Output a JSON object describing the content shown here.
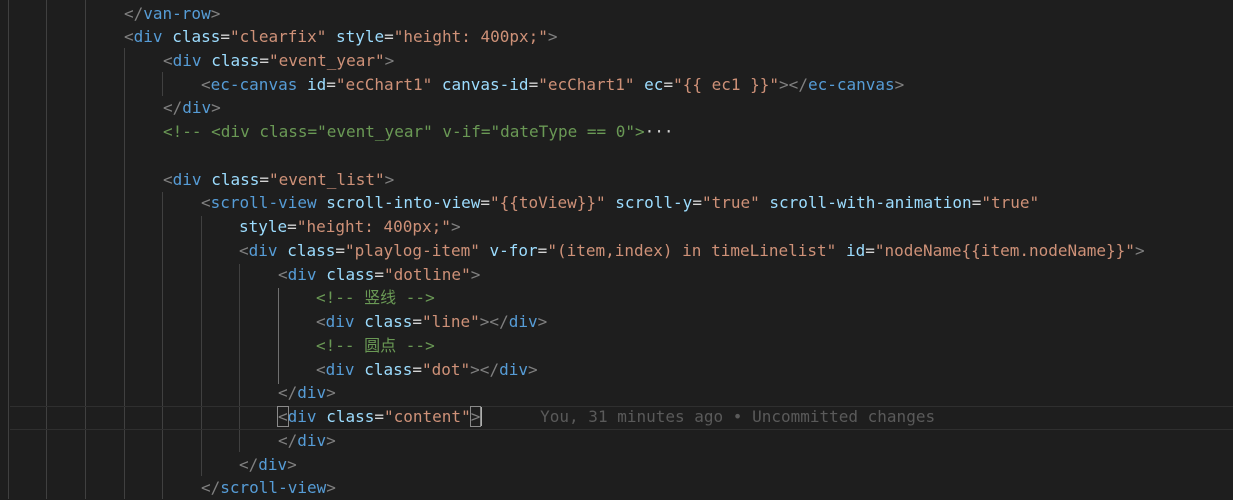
{
  "editor": {
    "lines": [
      [
        {
          "c": "t-punct",
          "t": "</"
        },
        {
          "c": "t-tag",
          "t": "van-row"
        },
        {
          "c": "t-punct",
          "t": ">"
        }
      ],
      [
        {
          "c": "t-punct",
          "t": "<"
        },
        {
          "c": "t-tag",
          "t": "div"
        },
        {
          "c": "t-eq",
          "t": " "
        },
        {
          "c": "t-attr",
          "t": "class"
        },
        {
          "c": "t-eq",
          "t": "="
        },
        {
          "c": "t-str",
          "t": "\"clearfix\""
        },
        {
          "c": "t-eq",
          "t": " "
        },
        {
          "c": "t-attr",
          "t": "style"
        },
        {
          "c": "t-eq",
          "t": "="
        },
        {
          "c": "t-str",
          "t": "\"height: 400px;\""
        },
        {
          "c": "t-punct",
          "t": ">"
        }
      ],
      [
        {
          "c": "t-punct",
          "t": "<"
        },
        {
          "c": "t-tag",
          "t": "div"
        },
        {
          "c": "t-eq",
          "t": " "
        },
        {
          "c": "t-attr",
          "t": "class"
        },
        {
          "c": "t-eq",
          "t": "="
        },
        {
          "c": "t-str",
          "t": "\"event_year\""
        },
        {
          "c": "t-punct",
          "t": ">"
        }
      ],
      [
        {
          "c": "t-punct",
          "t": "<"
        },
        {
          "c": "t-tag",
          "t": "ec-canvas"
        },
        {
          "c": "t-eq",
          "t": " "
        },
        {
          "c": "t-attr",
          "t": "id"
        },
        {
          "c": "t-eq",
          "t": "="
        },
        {
          "c": "t-str",
          "t": "\"ecChart1\""
        },
        {
          "c": "t-eq",
          "t": " "
        },
        {
          "c": "t-attr",
          "t": "canvas-id"
        },
        {
          "c": "t-eq",
          "t": "="
        },
        {
          "c": "t-str",
          "t": "\"ecChart1\""
        },
        {
          "c": "t-eq",
          "t": " "
        },
        {
          "c": "t-attr",
          "t": "ec"
        },
        {
          "c": "t-eq",
          "t": "="
        },
        {
          "c": "t-str",
          "t": "\"{{ ec1 }}\""
        },
        {
          "c": "t-punct",
          "t": "></"
        },
        {
          "c": "t-tag",
          "t": "ec-canvas"
        },
        {
          "c": "t-punct",
          "t": ">"
        }
      ],
      [
        {
          "c": "t-punct",
          "t": "</"
        },
        {
          "c": "t-tag",
          "t": "div"
        },
        {
          "c": "t-punct",
          "t": ">"
        }
      ],
      [
        {
          "c": "t-cmt",
          "t": "<!-- <div class=\"event_year\" v-if=\"dateType == 0\">"
        },
        {
          "c": "t-fold",
          "t": "···"
        }
      ],
      [],
      [
        {
          "c": "t-punct",
          "t": "<"
        },
        {
          "c": "t-tag",
          "t": "div"
        },
        {
          "c": "t-eq",
          "t": " "
        },
        {
          "c": "t-attr",
          "t": "class"
        },
        {
          "c": "t-eq",
          "t": "="
        },
        {
          "c": "t-str",
          "t": "\"event_list\""
        },
        {
          "c": "t-punct",
          "t": ">"
        }
      ],
      [
        {
          "c": "t-punct",
          "t": "<"
        },
        {
          "c": "t-tag",
          "t": "scroll-view"
        },
        {
          "c": "t-eq",
          "t": " "
        },
        {
          "c": "t-attr",
          "t": "scroll-into-view"
        },
        {
          "c": "t-eq",
          "t": "="
        },
        {
          "c": "t-str",
          "t": "\"{{toView}}\""
        },
        {
          "c": "t-eq",
          "t": " "
        },
        {
          "c": "t-attr",
          "t": "scroll-y"
        },
        {
          "c": "t-eq",
          "t": "="
        },
        {
          "c": "t-str",
          "t": "\"true\""
        },
        {
          "c": "t-eq",
          "t": " "
        },
        {
          "c": "t-attr",
          "t": "scroll-with-animation"
        },
        {
          "c": "t-eq",
          "t": "="
        },
        {
          "c": "t-str",
          "t": "\"true\""
        }
      ],
      [
        {
          "c": "t-attr",
          "t": "style"
        },
        {
          "c": "t-eq",
          "t": "="
        },
        {
          "c": "t-str",
          "t": "\"height: 400px;\""
        },
        {
          "c": "t-punct",
          "t": ">"
        }
      ],
      [
        {
          "c": "t-punct",
          "t": "<"
        },
        {
          "c": "t-tag",
          "t": "div"
        },
        {
          "c": "t-eq",
          "t": " "
        },
        {
          "c": "t-attr",
          "t": "class"
        },
        {
          "c": "t-eq",
          "t": "="
        },
        {
          "c": "t-str",
          "t": "\"playlog-item\""
        },
        {
          "c": "t-eq",
          "t": " "
        },
        {
          "c": "t-attr",
          "t": "v-for"
        },
        {
          "c": "t-eq",
          "t": "="
        },
        {
          "c": "t-str",
          "t": "\"(item,index) in timeLinelist\""
        },
        {
          "c": "t-eq",
          "t": " "
        },
        {
          "c": "t-attr",
          "t": "id"
        },
        {
          "c": "t-eq",
          "t": "="
        },
        {
          "c": "t-str",
          "t": "\"nodeName{{item.nodeName}}\""
        },
        {
          "c": "t-punct",
          "t": ">"
        }
      ],
      [
        {
          "c": "t-punct",
          "t": "<"
        },
        {
          "c": "t-tag",
          "t": "div"
        },
        {
          "c": "t-eq",
          "t": " "
        },
        {
          "c": "t-attr",
          "t": "class"
        },
        {
          "c": "t-eq",
          "t": "="
        },
        {
          "c": "t-str",
          "t": "\"dotline\""
        },
        {
          "c": "t-punct",
          "t": ">"
        }
      ],
      [
        {
          "c": "t-cmt",
          "t": "<!-- 竖线 -->"
        }
      ],
      [
        {
          "c": "t-punct",
          "t": "<"
        },
        {
          "c": "t-tag",
          "t": "div"
        },
        {
          "c": "t-eq",
          "t": " "
        },
        {
          "c": "t-attr",
          "t": "class"
        },
        {
          "c": "t-eq",
          "t": "="
        },
        {
          "c": "t-str",
          "t": "\"line\""
        },
        {
          "c": "t-punct",
          "t": "></"
        },
        {
          "c": "t-tag",
          "t": "div"
        },
        {
          "c": "t-punct",
          "t": ">"
        }
      ],
      [
        {
          "c": "t-cmt",
          "t": "<!-- 圆点 -->"
        }
      ],
      [
        {
          "c": "t-punct",
          "t": "<"
        },
        {
          "c": "t-tag",
          "t": "div"
        },
        {
          "c": "t-eq",
          "t": " "
        },
        {
          "c": "t-attr",
          "t": "class"
        },
        {
          "c": "t-eq",
          "t": "="
        },
        {
          "c": "t-str",
          "t": "\"dot\""
        },
        {
          "c": "t-punct",
          "t": "></"
        },
        {
          "c": "t-tag",
          "t": "div"
        },
        {
          "c": "t-punct",
          "t": ">"
        }
      ],
      [
        {
          "c": "t-punct",
          "t": "</"
        },
        {
          "c": "t-tag",
          "t": "div"
        },
        {
          "c": "t-punct",
          "t": ">"
        }
      ],
      [
        {
          "c": "t-punct bracket-box",
          "t": "<"
        },
        {
          "c": "t-tag",
          "t": "div"
        },
        {
          "c": "t-eq",
          "t": " "
        },
        {
          "c": "t-attr",
          "t": "class"
        },
        {
          "c": "t-eq",
          "t": "="
        },
        {
          "c": "t-str",
          "t": "\"content\""
        },
        {
          "c": "t-punct bracket-box",
          "t": ">"
        }
      ],
      [
        {
          "c": "t-punct",
          "t": "</"
        },
        {
          "c": "t-tag",
          "t": "div"
        },
        {
          "c": "t-punct",
          "t": ">"
        }
      ],
      [
        {
          "c": "t-punct",
          "t": "</"
        },
        {
          "c": "t-tag",
          "t": "div"
        },
        {
          "c": "t-punct",
          "t": ">"
        }
      ],
      [
        {
          "c": "t-punct",
          "t": "</"
        },
        {
          "c": "t-tag",
          "t": "scroll-view"
        },
        {
          "c": "t-punct",
          "t": ">"
        }
      ]
    ],
    "blame": "You, 31 minutes ago • Uncommitted changes",
    "cursor_line_index": 17,
    "colors": {
      "background": "#1e1e1e",
      "tag": "#569cd6",
      "attribute": "#9cdcfe",
      "string": "#ce9178",
      "comment": "#6a9955",
      "punctuation": "#808080",
      "blame": "#5a5a5a"
    }
  }
}
